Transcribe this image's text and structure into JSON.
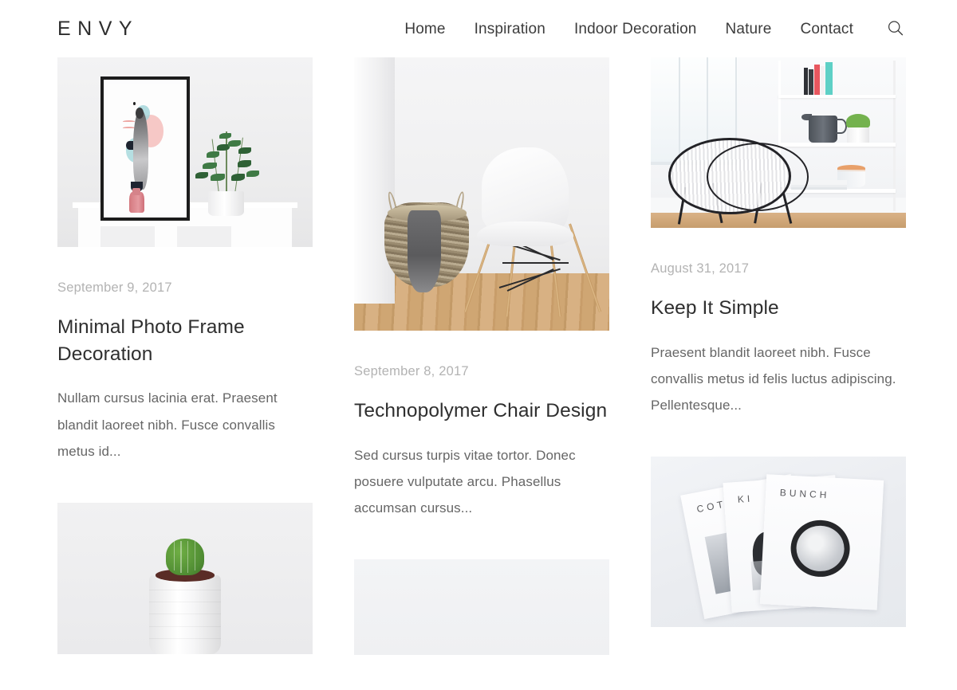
{
  "header": {
    "brand": "ENVY",
    "nav": [
      {
        "label": "Home"
      },
      {
        "label": "Inspiration"
      },
      {
        "label": "Indoor Decoration"
      },
      {
        "label": "Nature"
      },
      {
        "label": "Contact"
      }
    ],
    "search_icon": "search-icon"
  },
  "columns": [
    {
      "posts": [
        {
          "image": "framed-photo-frame-decoration",
          "date": "September 9, 2017",
          "title": "Minimal Photo Frame Decoration",
          "excerpt": "Nullam cursus lacinia erat. Praesent blandit laoreet nibh. Fusce convallis metus id..."
        },
        {
          "image": "cactus-in-white-pot",
          "date": "",
          "title": "",
          "excerpt": ""
        }
      ]
    },
    {
      "posts": [
        {
          "image": "white-chair-and-woven-basket",
          "date": "September 8, 2017",
          "title": "Technopolymer Chair Design",
          "excerpt": "Sed cursus turpis vitae tortor. Donec posuere vulputate arcu. Phasellus accumsan cursus..."
        },
        {
          "image": "pale-placeholder",
          "date": "",
          "title": "",
          "excerpt": ""
        }
      ]
    },
    {
      "posts": [
        {
          "image": "round-chair-and-white-shelf",
          "date": "August 31, 2017",
          "title": "Keep It Simple",
          "excerpt": "Praesent blandit laoreet nibh. Fusce convallis metus id felis luctus adipiscing. Pellentesque..."
        },
        {
          "image": "stacked-magazines",
          "date": "",
          "title": "",
          "excerpt": ""
        }
      ]
    }
  ],
  "magazines": {
    "labels": [
      "COT",
      "KI",
      "BUNCH"
    ]
  },
  "colors": {
    "page_background": "#ffffff",
    "brand_text": "#2d2d2d",
    "nav_text": "#3c3c3c",
    "post_title": "#2f2f2f",
    "post_date": "#b3b3b3",
    "post_excerpt": "#666666"
  }
}
